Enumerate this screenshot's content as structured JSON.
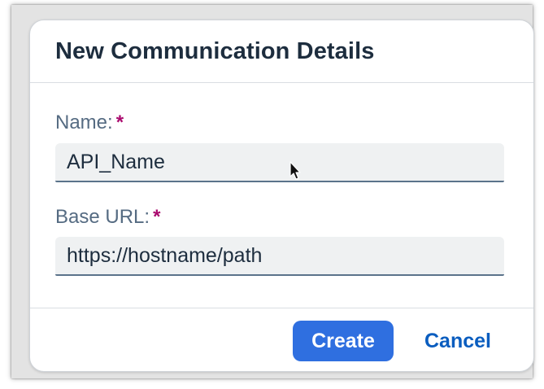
{
  "dialog": {
    "title": "New Communication Details",
    "fields": [
      {
        "label": "Name:",
        "required_mark": "*",
        "value": "API_Name"
      },
      {
        "label": "Base URL:",
        "required_mark": "*",
        "value": "https://hostname/path"
      }
    ],
    "buttons": {
      "create_label": "Create",
      "cancel_label": "Cancel"
    }
  },
  "colors": {
    "title": "#1d2d3e",
    "label": "#556b82",
    "required": "#aa0a6e",
    "primary_button": "#2f6fe0",
    "link": "#0a5dbf"
  },
  "icons": {
    "pointer": "mouse-pointer-icon"
  }
}
